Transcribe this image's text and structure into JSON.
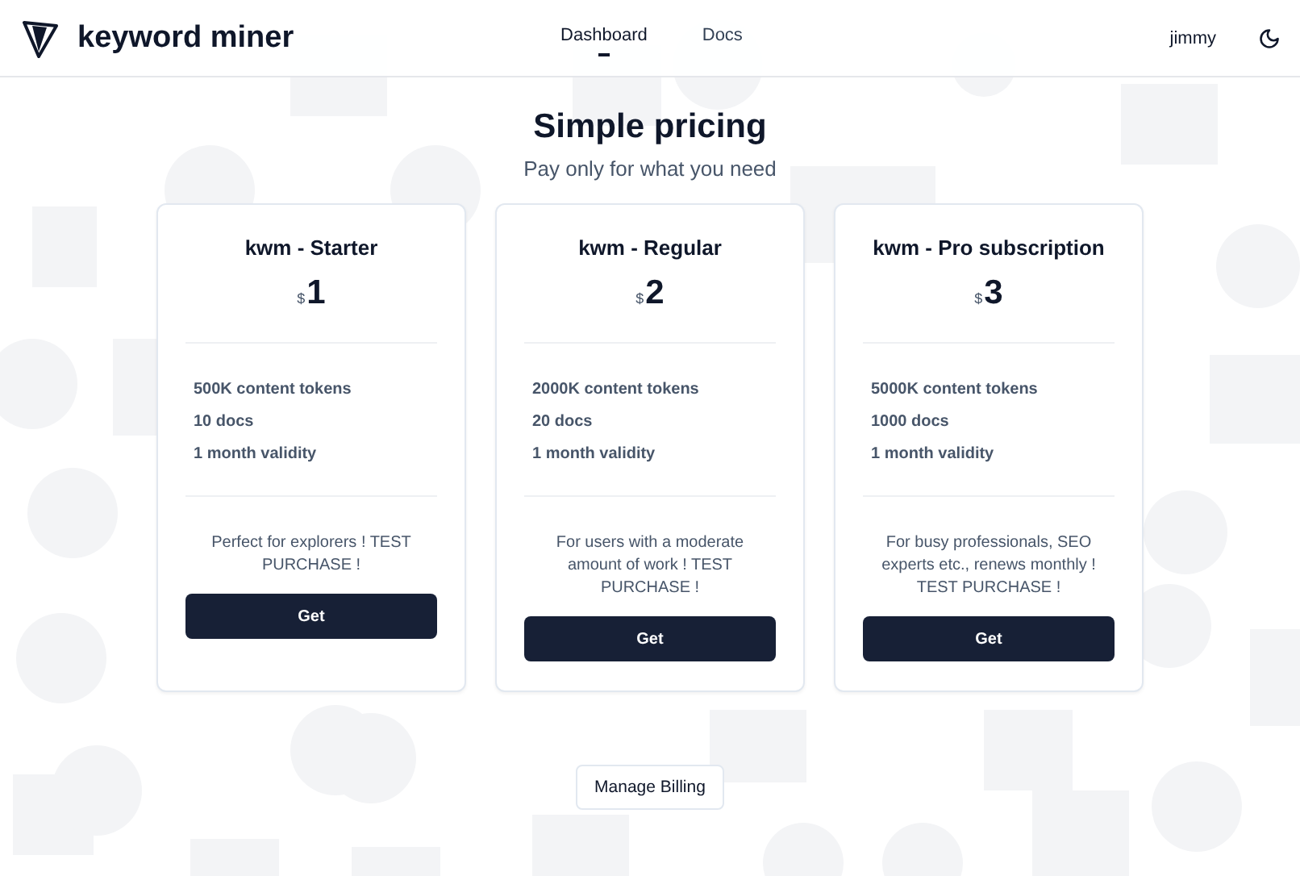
{
  "header": {
    "brand": "keyword miner",
    "nav": [
      {
        "label": "Dashboard",
        "selected": true
      },
      {
        "label": "Docs",
        "selected": false
      }
    ],
    "user": "jimmy"
  },
  "hero": {
    "title": "Simple pricing",
    "subtitle": "Pay only for what you need"
  },
  "plans": [
    {
      "name": "kwm - Starter",
      "currency": "$",
      "price": "1",
      "features": [
        "500K content tokens",
        "10 docs",
        "1 month validity"
      ],
      "description": "Perfect for explorers ! TEST PURCHASE !",
      "button": "Get"
    },
    {
      "name": "kwm - Regular",
      "currency": "$",
      "price": "2",
      "features": [
        "2000K content tokens",
        "20 docs",
        "1 month validity"
      ],
      "description": "For users with a moderate amount of work ! TEST PURCHASE !",
      "button": "Get"
    },
    {
      "name": "kwm - Pro subscription",
      "currency": "$",
      "price": "3",
      "features": [
        "5000K content tokens",
        "1000 docs",
        "1 month validity"
      ],
      "description": "For busy professionals, SEO experts etc., renews monthly ! TEST PURCHASE !",
      "button": "Get"
    }
  ],
  "billing_button": "Manage Billing"
}
